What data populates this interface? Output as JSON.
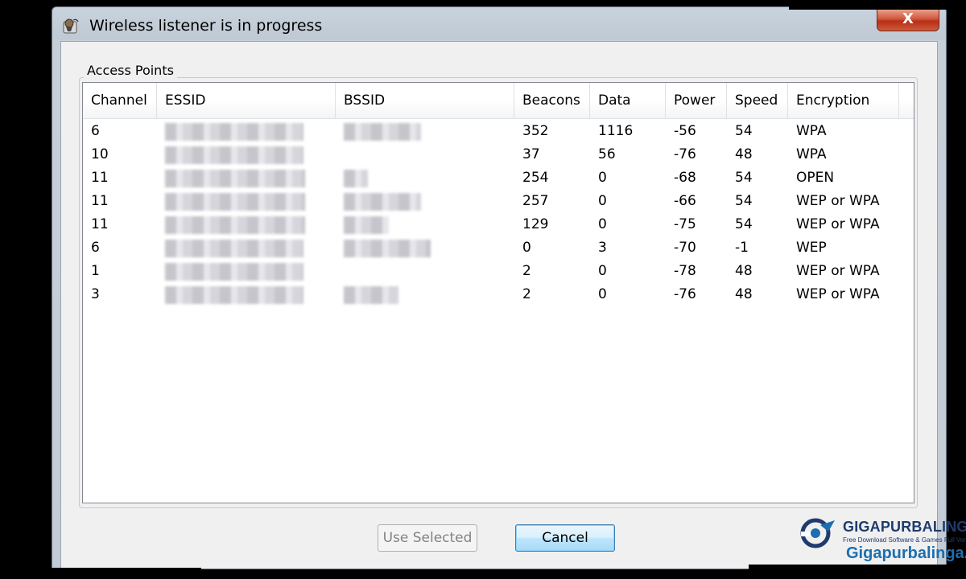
{
  "window": {
    "title": "Wireless listener is in progress",
    "close_label": "X"
  },
  "group": {
    "label": "Access Points"
  },
  "table": {
    "columns": [
      "Channel",
      "ESSID",
      "BSSID",
      "Beacons",
      "Data",
      "Power",
      "Speed",
      "Encryption"
    ],
    "rows": [
      {
        "channel": "6",
        "beacons": "352",
        "data": "1116",
        "power": "-56",
        "speed": "54",
        "encryption": "WPA",
        "bssid_blurred": true
      },
      {
        "channel": "10",
        "beacons": "37",
        "data": "56",
        "power": "-76",
        "speed": "48",
        "encryption": "WPA",
        "bssid_blurred": false
      },
      {
        "channel": "11",
        "beacons": "254",
        "data": "0",
        "power": "-68",
        "speed": "54",
        "encryption": "OPEN",
        "bssid_blurred": true
      },
      {
        "channel": "11",
        "beacons": "257",
        "data": "0",
        "power": "-66",
        "speed": "54",
        "encryption": "WEP or WPA",
        "bssid_blurred": true
      },
      {
        "channel": "11",
        "beacons": "129",
        "data": "0",
        "power": "-75",
        "speed": "54",
        "encryption": "WEP or WPA",
        "bssid_blurred": true
      },
      {
        "channel": "6",
        "beacons": "0",
        "data": "3",
        "power": "-70",
        "speed": "-1",
        "encryption": "WEP",
        "bssid_blurred": true
      },
      {
        "channel": "1",
        "beacons": "2",
        "data": "0",
        "power": "-78",
        "speed": "48",
        "encryption": "WEP or WPA",
        "bssid_blurred": false
      },
      {
        "channel": "3",
        "beacons": "2",
        "data": "0",
        "power": "-76",
        "speed": "48",
        "encryption": "WEP or WPA",
        "bssid_blurred": true
      }
    ]
  },
  "buttons": {
    "use_selected": "Use Selected",
    "cancel": "Cancel"
  },
  "watermark": {
    "brand_a": "GIGA",
    "brand_b": "PURBALINGGA",
    "tagline": "Free Download Software & Games Full Version",
    "url": "Gigapurbalinga.cc"
  },
  "colors": {
    "accent": "#3c7fb1",
    "close": "#c84a2e",
    "watermark": "#1b6fb0"
  }
}
